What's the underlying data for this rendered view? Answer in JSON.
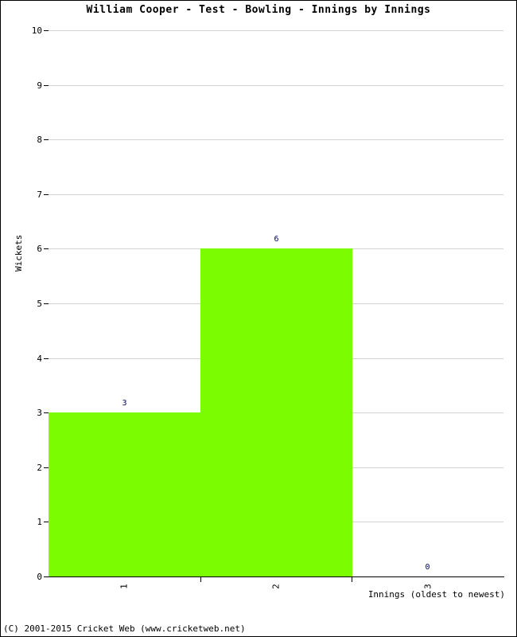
{
  "chart_data": {
    "type": "bar",
    "title": "William Cooper - Test - Bowling - Innings by Innings",
    "categories": [
      "1",
      "2",
      "3"
    ],
    "values": [
      3,
      6,
      0
    ],
    "data_labels": [
      "3",
      "6",
      "0"
    ],
    "xlabel": "Innings (oldest to newest)",
    "ylabel": "Wickets",
    "ylim": [
      0,
      10
    ],
    "yticks": [
      0,
      1,
      2,
      3,
      4,
      5,
      6,
      7,
      8,
      9,
      10
    ],
    "ytick_labels": [
      "0",
      "1",
      "2",
      "3",
      "4",
      "5",
      "6",
      "7",
      "8",
      "9",
      "10"
    ],
    "grid": true,
    "legend": null,
    "series": [
      {
        "name": "Wickets",
        "values": [
          3,
          6,
          0
        ],
        "color": "#7CFC00"
      }
    ],
    "bar_color": "#7CFC00",
    "label_color": "#000060",
    "gridline_color": "#D2D2D2",
    "axis_color": "#000000",
    "background_color": "#FFFFFF"
  },
  "footer": {
    "copyright": "(C) 2001-2015 Cricket Web (www.cricketweb.net)"
  }
}
